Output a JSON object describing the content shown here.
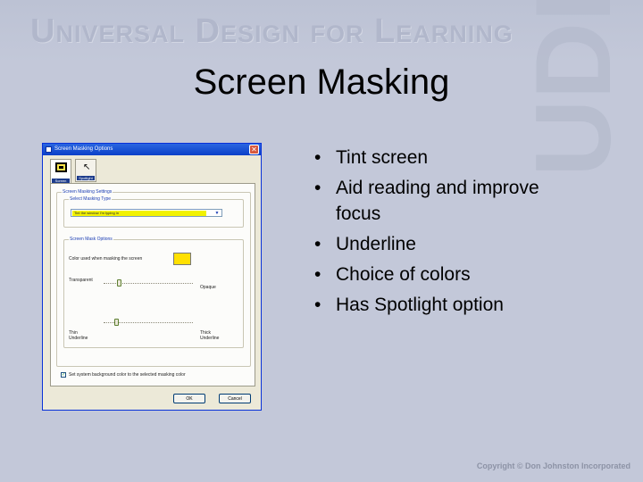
{
  "header": {
    "brand_text": "Universal Design for Learning"
  },
  "logo": {
    "text": "UDL"
  },
  "slide": {
    "title": "Screen Masking",
    "bullets": [
      "Tint screen",
      "Aid reading and improve focus",
      "Underline",
      "Choice of colors",
      "Has Spotlight option"
    ]
  },
  "dialog": {
    "title": "Screen Masking Options",
    "close_symbol": "✕",
    "tabs": [
      "Screen",
      "Spotlight"
    ],
    "settings_group": "Screen Masking Settings",
    "type_group": "Select Masking Type",
    "masking_type_value": "Tint the window I'm typing in",
    "mask_options_group": "Screen Mask Options",
    "color_label": "Color used when masking the screen",
    "color_value": "#ffe000",
    "slider1": {
      "left_label": "Transparent",
      "right_label": "Opaque",
      "value": 0.15
    },
    "slider2": {
      "left_label_line1": "Thin",
      "left_label_line2": "Underline",
      "right_label_line1": "Thick",
      "right_label_line2": "Underline",
      "value": 0.12
    },
    "checkbox_label": "Set system background color to the selected masking color",
    "checkbox_checked": true,
    "ok_label": "OK",
    "cancel_label": "Cancel"
  },
  "footer": {
    "copyright": "Copyright © Don Johnston Incorporated"
  },
  "colors": {
    "background": "#c3c8d9",
    "titlebar": "#0a3fc8",
    "mask_color": "#ffe000"
  }
}
